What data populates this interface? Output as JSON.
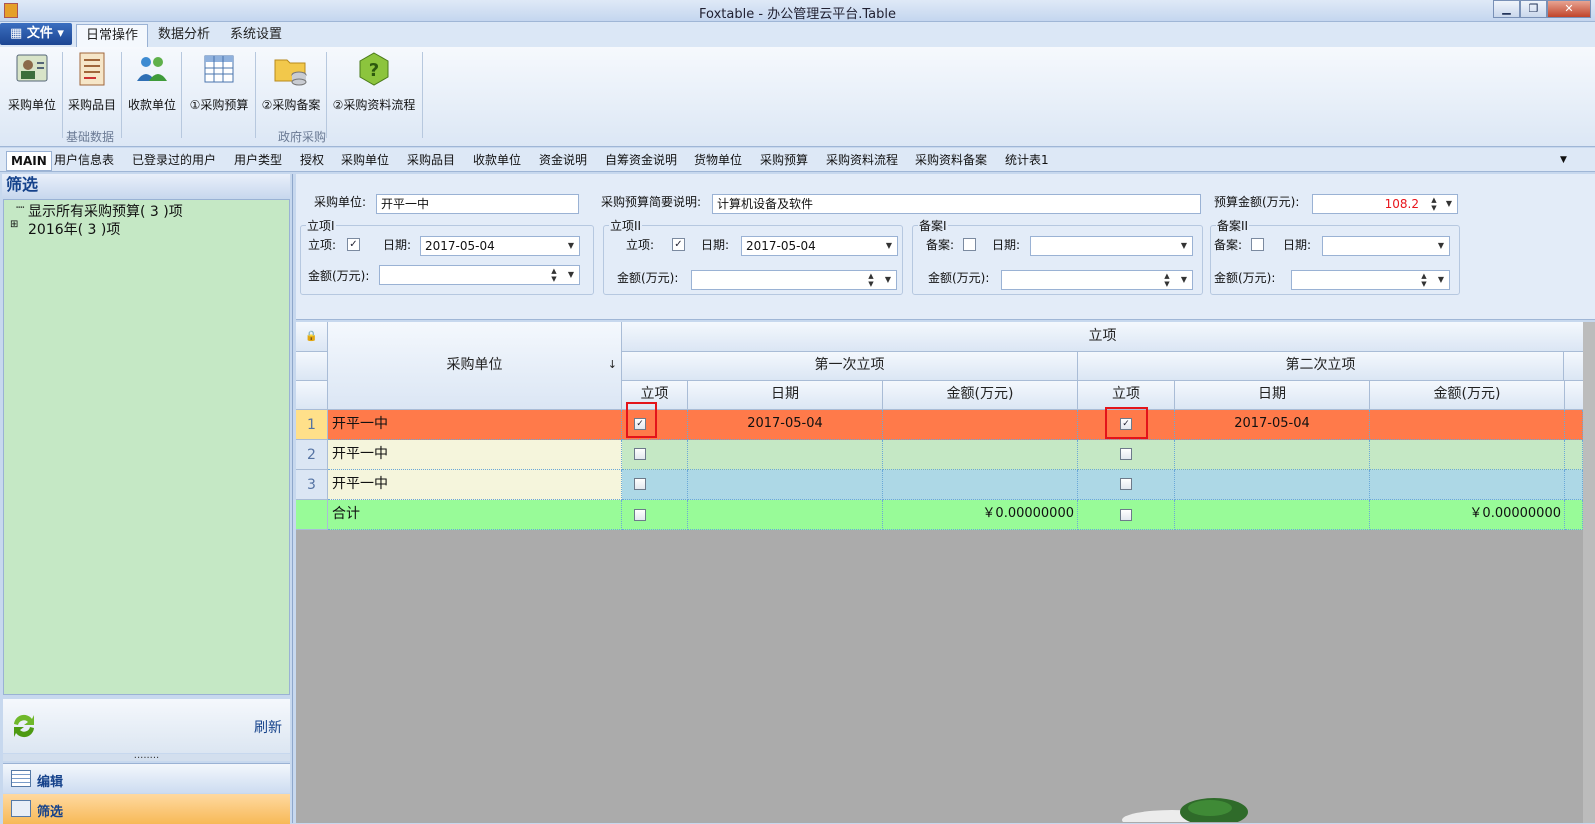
{
  "window": {
    "title": "Foxtable - 办公管理云平台.Table",
    "buttons": [
      "minimize",
      "restore",
      "close"
    ]
  },
  "menu": {
    "file_label": "文件",
    "tabs": [
      "日常操作",
      "数据分析",
      "系统设置"
    ]
  },
  "ribbon": {
    "buttons": [
      {
        "label": "采购单位",
        "icon": "user-card-icon"
      },
      {
        "label": "采购品目",
        "icon": "list-document-icon"
      },
      {
        "label": "收款单位",
        "icon": "people-group-icon"
      },
      {
        "label": "①采购预算",
        "icon": "spreadsheet-icon"
      },
      {
        "label": "②采购备案",
        "icon": "folder-database-icon"
      },
      {
        "label": "②采购资料流程",
        "icon": "help-question-icon"
      }
    ],
    "groups": [
      "基础数据",
      "政府采购"
    ]
  },
  "doc_tabs": [
    "MAIN",
    "用户信息表",
    "已登录过的用户",
    "用户类型",
    "授权",
    "采购单位",
    "采购品目",
    "收款单位",
    "资金说明",
    "自筹资金说明",
    "货物单位",
    "采购预算",
    "采购资料流程",
    "采购资料备案",
    "统计表1"
  ],
  "left_panel": {
    "title": "筛选",
    "tree": [
      "显示所有采购预算( 3 )项",
      "2016年( 3 )项"
    ],
    "refresh_label": "刷新",
    "grip": "........",
    "nav": [
      "编辑",
      "筛选"
    ]
  },
  "form": {
    "unit_label": "采购单位:",
    "unit_value": "开平一中",
    "summary_label": "采购预算简要说明:",
    "summary_value": "计算机设备及软件",
    "budget_label": "预算金额(万元):",
    "budget_value": "108.2",
    "groups": [
      {
        "title": "立项I",
        "check_label": "立项:",
        "checked": true,
        "date_label": "日期:",
        "date": "2017-05-04",
        "amount_label": "金额(万元):",
        "amount": ""
      },
      {
        "title": "立项II",
        "check_label": "立项:",
        "checked": true,
        "date_label": "日期:",
        "date": "2017-05-04",
        "amount_label": "金额(万元):",
        "amount": ""
      },
      {
        "title": "备案I",
        "check_label": "备案:",
        "checked": false,
        "date_label": "日期:",
        "date": "",
        "amount_label": "金额(万元):",
        "amount": ""
      },
      {
        "title": "备案II",
        "check_label": "备案:",
        "checked": false,
        "date_label": "日期:",
        "date": "",
        "amount_label": "金额(万元):",
        "amount": ""
      }
    ]
  },
  "grid": {
    "header_unit": "采购单位",
    "header_top": "立项",
    "header_first": "第一次立项",
    "header_second": "第二次立项",
    "sub_headers": [
      "立项",
      "日期",
      "金额(万元)",
      "立项",
      "日期",
      "金额(万元)"
    ],
    "rows": [
      {
        "num": "1",
        "unit": "开平一中",
        "c1": true,
        "d1": "2017-05-04",
        "a1": "",
        "c2": true,
        "d2": "2017-05-04",
        "a2": ""
      },
      {
        "num": "2",
        "unit": "开平一中",
        "c1": false,
        "d1": "",
        "a1": "",
        "c2": false,
        "d2": "",
        "a2": ""
      },
      {
        "num": "3",
        "unit": "开平一中",
        "c1": false,
        "d1": "",
        "a1": "",
        "c2": false,
        "d2": "",
        "a2": ""
      }
    ],
    "total": {
      "label": "合计",
      "a1": "￥0.00000000",
      "a2": "￥0.00000000"
    },
    "colors": {
      "selected_row": "#ff7a4a",
      "row2": "#c5e8c5",
      "row3": "#add8e6",
      "total_row": "#98fb98",
      "unit_col": "#f5f5dc",
      "highlight_box": "#e3141a"
    }
  }
}
